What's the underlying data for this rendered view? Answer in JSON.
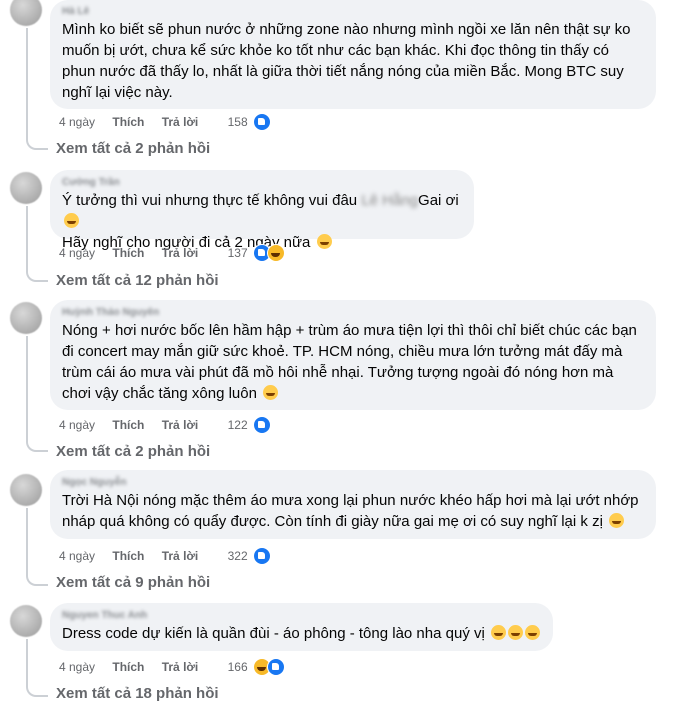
{
  "comments": [
    {
      "author": "Hà Lê",
      "text": "Mình ko biết sẽ phun nước ở những zone nào nhưng mình ngồi xe lăn nên thật sự ko muốn bị ướt, chưa kể sức khỏe ko tốt như các bạn khác. Khi đọc thông tin thấy có phun nước đã thấy lo, nhất là giữa thời tiết nắng nóng của miền Bắc. Mong BTC suy nghĩ lại việc này.",
      "time": "4 ngày",
      "like": "Thích",
      "reply": "Trả lời",
      "reaction_count": "158",
      "reactions": [
        "like-icon"
      ],
      "view_replies": "Xem tất cả 2 phản hồi"
    },
    {
      "author": "Cường Trần",
      "text_part1": "Ý tưởng thì vui nhưng thực tế không vui đâu ",
      "text_mention": "Lê Hằng",
      "text_part2": "Gai ơi",
      "text_line2": "Hãy nghĩ cho người đi cả 2 ngày nữa",
      "time": "4 ngày",
      "like": "Thích",
      "reply": "Trả lời",
      "reaction_count": "137",
      "reactions": [
        "like-icon",
        "haha-icon"
      ],
      "view_replies": "Xem tất cả 12 phản hồi"
    },
    {
      "author": "Huỳnh Thảo Nguyên",
      "text": "Nóng + hơi nước bốc lên hầm hập + trùm áo mưa tiện lợi thì thôi chỉ biết chúc các bạn đi concert may mắn giữ sức khoẻ. TP. HCM nóng, chiều mưa lớn tưởng mát đấy mà trùm cái áo mưa vài phút đã mồ hôi nhễ nhại. Tưởng tượng ngoài đó nóng hơn mà chơi vậy chắc tăng xông luôn",
      "time": "4 ngày",
      "like": "Thích",
      "reply": "Trả lời",
      "reaction_count": "122",
      "reactions": [
        "like-icon"
      ],
      "view_replies": "Xem tất cả 2 phản hồi"
    },
    {
      "author": "Ngọc Nguyễn",
      "text": "Trời Hà Nội nóng mặc thêm áo mưa xong lại phun nước khéo hấp hơi mà lại ướt nhớp nháp quá không có quẩy được. Còn tính đi giày nữa gai mẹ ơi có suy nghĩ lại k zị",
      "time": "4 ngày",
      "like": "Thích",
      "reply": "Trả lời",
      "reaction_count": "322",
      "reactions": [
        "like-icon"
      ],
      "view_replies": "Xem tất cả 9 phản hồi"
    },
    {
      "author": "Nguyen Thuc Anh",
      "text": "Dress code dự kiến là quần đùi - áo phông - tông lào nha quý vị",
      "time": "4 ngày",
      "like": "Thích",
      "reply": "Trả lời",
      "reaction_count": "166",
      "reactions": [
        "haha-icon",
        "like-icon"
      ],
      "view_replies": "Xem tất cả 18 phản hồi"
    }
  ]
}
